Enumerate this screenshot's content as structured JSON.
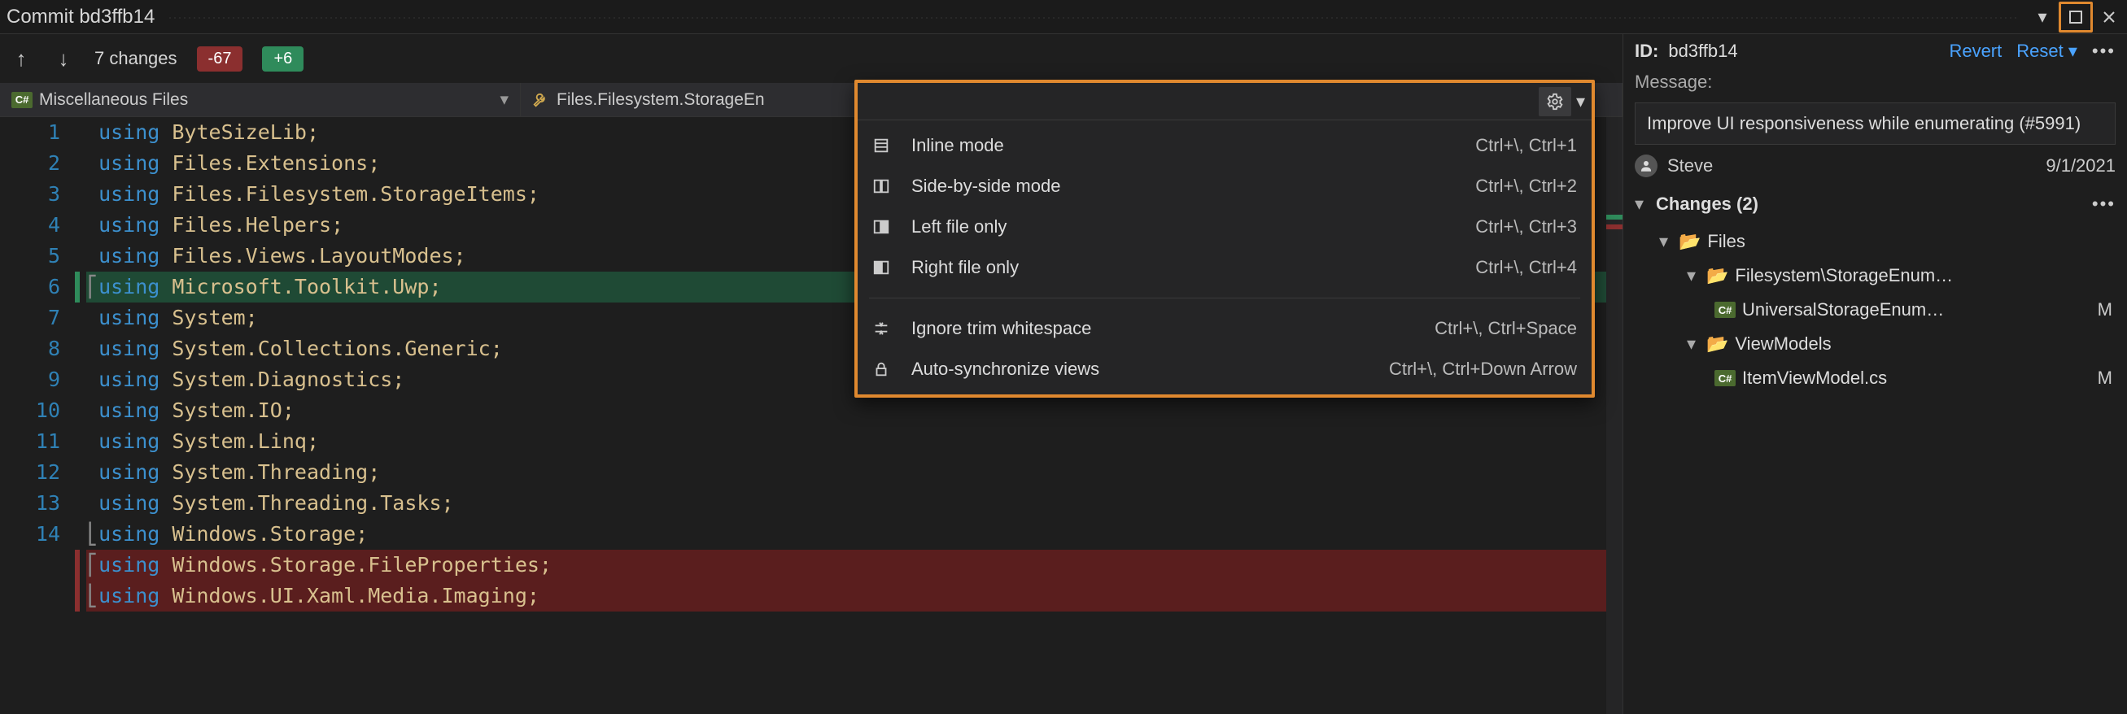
{
  "title": "Commit bd3ffb14",
  "toolbar": {
    "changes_label": "7 changes",
    "deleted_badge": "-67",
    "added_badge": "+6"
  },
  "tabs": {
    "left": "Miscellaneous Files",
    "right": "Files.Filesystem.StorageEn"
  },
  "code": {
    "lines": [
      {
        "n": 1,
        "kw": "using",
        "rest": " ByteSizeLib;",
        "kind": ""
      },
      {
        "n": 2,
        "kw": "using",
        "rest": " Files.Extensions;",
        "kind": ""
      },
      {
        "n": 3,
        "kw": "using",
        "rest": " Files.Filesystem.StorageItems;",
        "kind": ""
      },
      {
        "n": 4,
        "kw": "using",
        "rest": " Files.Helpers;",
        "kind": ""
      },
      {
        "n": 5,
        "kw": "using",
        "rest": " Files.Views.LayoutModes;",
        "kind": ""
      },
      {
        "n": 6,
        "kw": "using",
        "rest": " Microsoft.Toolkit.Uwp;",
        "kind": "added",
        "br_open": true
      },
      {
        "n": 7,
        "kw": "using",
        "rest": " System;",
        "kind": ""
      },
      {
        "n": 8,
        "kw": "using",
        "rest": " System.Collections.Generic;",
        "kind": ""
      },
      {
        "n": 9,
        "kw": "using",
        "rest": " System.Diagnostics;",
        "kind": ""
      },
      {
        "n": 10,
        "kw": "using",
        "rest": " System.IO;",
        "kind": ""
      },
      {
        "n": 11,
        "kw": "using",
        "rest": " System.Linq;",
        "kind": ""
      },
      {
        "n": 12,
        "kw": "using",
        "rest": " System.Threading;",
        "kind": ""
      },
      {
        "n": 13,
        "kw": "using",
        "rest": " System.Threading.Tasks;",
        "kind": ""
      },
      {
        "n": 14,
        "kw": "using",
        "rest": " Windows.Storage;",
        "kind": "",
        "br_close": true
      },
      {
        "n": "",
        "kw": "using",
        "rest": " Windows.Storage.FileProperties;",
        "kind": "deleted",
        "br_open": true
      },
      {
        "n": "",
        "kw": "using",
        "rest": " Windows.UI.Xaml.Media.Imaging;",
        "kind": "deleted",
        "br_close": true
      }
    ]
  },
  "menu": {
    "items": [
      {
        "icon": "inline-icon",
        "label": "Inline mode",
        "shortcut": "Ctrl+\\, Ctrl+1"
      },
      {
        "icon": "sidebyside-icon",
        "label": "Side-by-side mode",
        "shortcut": "Ctrl+\\, Ctrl+2"
      },
      {
        "icon": "leftfile-icon",
        "label": "Left file only",
        "shortcut": "Ctrl+\\, Ctrl+3"
      },
      {
        "icon": "rightfile-icon",
        "label": "Right file only",
        "shortcut": "Ctrl+\\, Ctrl+4"
      }
    ],
    "items2": [
      {
        "icon": "trim-icon",
        "label": "Ignore trim whitespace",
        "shortcut": "Ctrl+\\, Ctrl+Space"
      },
      {
        "icon": "lock-icon",
        "label": "Auto-synchronize views",
        "shortcut": "Ctrl+\\, Ctrl+Down Arrow"
      }
    ]
  },
  "side": {
    "id_label": "ID:",
    "id_value": "bd3ffb14",
    "revert": "Revert",
    "reset": "Reset",
    "message_label": "Message:",
    "message_body": "Improve UI responsiveness while enumerating (#5991)",
    "author": "Steve",
    "date": "9/1/2021",
    "changes_header": "Changes (2)",
    "tree": {
      "root": "Files",
      "folder1": "Filesystem\\StorageEnum…",
      "file1": "UniversalStorageEnum…",
      "file1_status": "M",
      "folder2": "ViewModels",
      "file2": "ItemViewModel.cs",
      "file2_status": "M"
    }
  },
  "csharp_badge": "C#"
}
